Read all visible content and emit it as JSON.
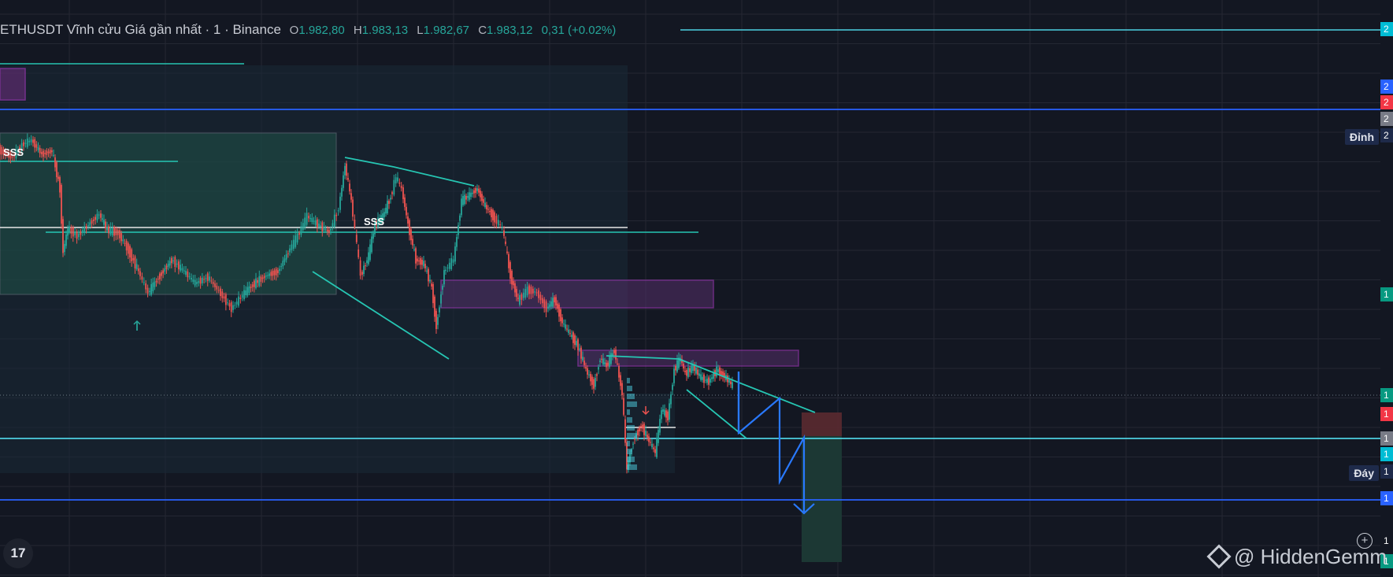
{
  "header": {
    "symbol": "ETHUSDT Vĩnh cửu Giá gần nhất · 1 · Binance",
    "o_label": "O",
    "o_value": "1.982,80",
    "h_label": "H",
    "h_value": "1.983,13",
    "l_label": "L",
    "l_value": "1.982,67",
    "c_label": "C",
    "c_value": "1.983,12",
    "change": "0,31 (+0.02%)"
  },
  "annotations": {
    "sss_left": "SSS",
    "sss_mid": "SSS",
    "top_label": "Đỉnh",
    "bottom_label": "Đáy"
  },
  "axis_tags": [
    {
      "text": "2",
      "color": "#00bcd4"
    },
    {
      "text": "2",
      "color": "#2962ff"
    },
    {
      "text": "2",
      "color": "#f23645"
    },
    {
      "text": "2",
      "color": "#787b86"
    },
    {
      "text": "2",
      "color": "#1e2a4a"
    },
    {
      "text": "1",
      "color": "#089981"
    },
    {
      "text": "1",
      "color": "#089981"
    },
    {
      "text": "1",
      "color": "#f23645"
    },
    {
      "text": "1",
      "color": "#787b86"
    },
    {
      "text": "1",
      "color": "#00bcd4"
    },
    {
      "text": "1",
      "color": "#1e2a4a"
    },
    {
      "text": "1",
      "color": "#2962ff"
    },
    {
      "text": "1",
      "color": "#131722"
    },
    {
      "text": "1",
      "color": "#089981"
    }
  ],
  "tv_logo": "17",
  "watermark": "@ HiddenGemm",
  "chart_data": {
    "type": "candlestick",
    "series": [
      {
        "name": "ETHUSDT",
        "note": "1-minute candles"
      }
    ],
    "colors": {
      "up": "#26a69a",
      "down": "#ef5350",
      "trend": "#26c6b3",
      "level_cyan": "#4dd0e1",
      "level_blue": "#2962ff",
      "zone_purple": "#b33ccc",
      "projection": "#2979ff"
    }
  }
}
